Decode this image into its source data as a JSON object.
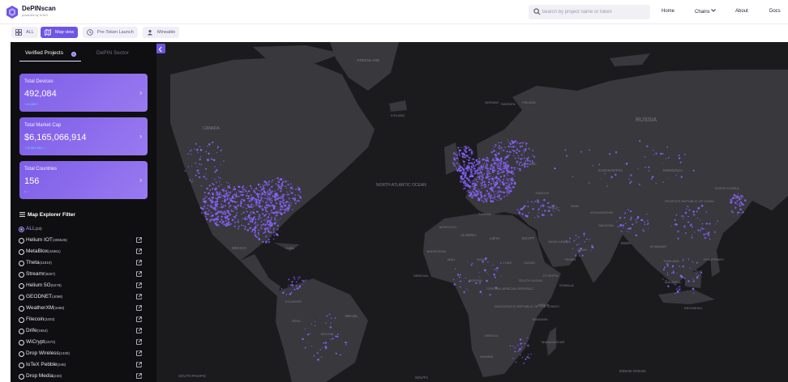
{
  "brand": {
    "name": "DePINscan",
    "subtitle": "powered by IoTeX",
    "logo_icon": "depinscan-logo-icon"
  },
  "search": {
    "placeholder": "Search by project name or token"
  },
  "nav": [
    "Home",
    "Chains",
    "About",
    "Docs"
  ],
  "modes": [
    {
      "label": "ALL",
      "icon": "grid-icon",
      "active": false
    },
    {
      "label": "Map view",
      "icon": "map-icon",
      "active": true
    },
    {
      "label": "Pre-Token Launch",
      "icon": "clock-icon",
      "active": false
    },
    {
      "label": "Mineable",
      "icon": "mining-icon",
      "active": false
    }
  ],
  "sidebar": {
    "tabs": [
      "Verified Projects",
      "DePIN Sector"
    ],
    "cards": [
      {
        "label": "Total Devices",
        "value": "492,084",
        "change": "+14,288 ↑"
      },
      {
        "label": "Total Market Cap",
        "value": "$6,165,066,914",
        "change": "+78,591,531 ↑"
      },
      {
        "label": "Total Countries",
        "value": "156",
        "change": "0 ↑"
      }
    ],
    "filter_title": "Map Explorer Filter",
    "filters": [
      {
        "name": "ALL",
        "count": "(23)",
        "selected": true
      },
      {
        "name": "Helium IOT",
        "count": "(405525)"
      },
      {
        "name": "MetaBlox",
        "count": "(44661)"
      },
      {
        "name": "Theta",
        "count": "(11910)"
      },
      {
        "name": "Streamr",
        "count": "(8267)"
      },
      {
        "name": "Helium 5G",
        "count": "(5278)"
      },
      {
        "name": "GEODNET",
        "count": "(4098)"
      },
      {
        "name": "WeatherXM",
        "count": "(3498)"
      },
      {
        "name": "Filecoin",
        "count": "(3203)"
      },
      {
        "name": "Drife",
        "count": "(1654)"
      },
      {
        "name": "WiCrypt",
        "count": "(1572)"
      },
      {
        "name": "Drop Wireless",
        "count": "(1330)"
      },
      {
        "name": "IoTeX Pebble",
        "count": "(248)"
      },
      {
        "name": "Drop Media",
        "count": "(230)"
      }
    ]
  },
  "map": {
    "ocean_color": "#1b1b1e",
    "land_color": "#38383d",
    "device_color": "#8a63ff",
    "labels": {
      "canada": "CANADA",
      "north_atlantic": "NORTH ATLANTIC OCEAN",
      "iceland": "ICELAND",
      "norway": "NORWAY",
      "sweden": "SWEDEN",
      "finland": "FINLAND",
      "russia": "RUSSIA",
      "kazakhstan": "KAZAKHSTAN",
      "mongolia": "MONGOLIA",
      "china": "PEOPLE'S REPUBLIC OF CHINA",
      "japan": "JAPAN",
      "north_korea": "NORTH KOREA",
      "ukraine": "UKRAINE",
      "turkey": "TÜRKIYE",
      "iran": "IRAN",
      "iraq": "IRAQ",
      "afghanistan": "AFGHANISTAN",
      "pakistan": "PAKISTAN",
      "india": "INDIA",
      "algeria": "ALGERIA",
      "libya": "LIBYA",
      "egypt": "EGYPT",
      "mauritania": "MAURITANIA",
      "mali": "MALI",
      "niger": "NIGER",
      "chad": "CHAD",
      "sudan": "SUDAN",
      "nigeria": "NIGERIA",
      "ethiopia": "ETHIOPIA",
      "senegal": "SENEGAL",
      "kenya": "KENYA",
      "tanzania": "TANZANIA",
      "angola": "ANGOLA",
      "namibia": "NAMIBIA",
      "madagascar": "MADAGASCAR",
      "saudi": "SAUDI ARABIA",
      "yemen": "YEMEN",
      "oman": "OMAN",
      "myanmar": "MYANMAR",
      "thailand": "THAILAND",
      "philippines": "PHILIPPINES",
      "malaysia": "MALAYSIA",
      "indonesia": "INDONESIA",
      "cuba": "CUBA",
      "mexico": "MEXICO",
      "ecuador": "ECUADOR",
      "peru": "PERU",
      "brazil": "BRAZIL",
      "bolivia": "BOLIVIA",
      "greenland": "GREENLAND",
      "indian_ocean": "INDIAN OCEAN",
      "south_pacific": "SOUTH PACIFIC",
      "south": "SOUTH",
      "somalia": "SOMALIA",
      "drc": "DEMOCRATIC REPUBLIC OF THE CONGO",
      "tunisia": "TUNISIA",
      "morocco": "MOROCCO",
      "south_sudan": "SOUTH SUDAN",
      "central_african": "CENTRAL AFRICAN REPUBLIC"
    }
  }
}
